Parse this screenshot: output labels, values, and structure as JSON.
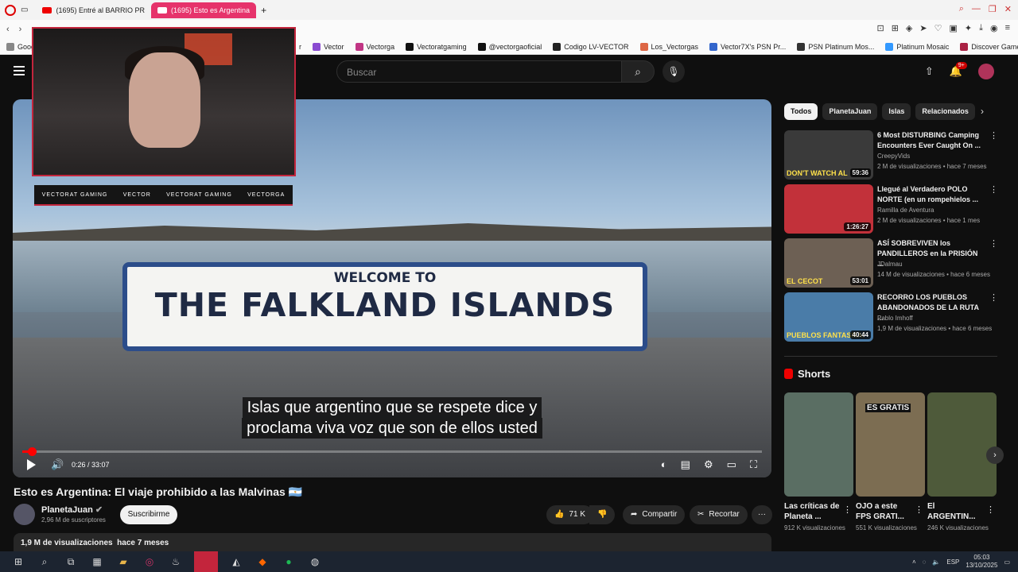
{
  "browser": {
    "tabs": [
      {
        "title": "(1695) Entré al BARRIO PR",
        "active": false
      },
      {
        "title": "(1695) Esto es Argentina",
        "active": true
      }
    ],
    "new_tab": "+",
    "bookmarks": [
      "Goog",
      "r",
      "Vector",
      "Vectorga",
      "Vectoratgaming",
      "@vectorgaoficial",
      "Codigo LV-VECTOR",
      "Los_Vectorgas",
      "Vector7X's PSN Pr...",
      "PSN Platinum Mos...",
      "Platinum Mosaic",
      "Discover Games -..."
    ]
  },
  "header": {
    "search_placeholder": "Buscar",
    "notifications_badge": "9+"
  },
  "video": {
    "sign_small": "WELCOME TO",
    "sign_big": "THE FALKLAND ISLANDS",
    "subtitle_line1": "Islas que argentino que se respete dice y",
    "subtitle_line2": "proclama viva voz que son de ellos usted",
    "time": "0:26 / 33:07",
    "progress_fraction": 0.013,
    "overlay_social": [
      "VECTORAT GAMING",
      "VECTOR",
      "VECTORAT GAMING",
      "VECTORGA"
    ],
    "title": "Esto es Argentina: El viaje prohibido a las Malvinas 🇦🇷"
  },
  "channel": {
    "name": "PlanetaJuan",
    "subscribers": "2,96 M de suscriptores",
    "subscribe_label": "Suscribirme"
  },
  "actions": {
    "likes": "71 K",
    "share": "Compartir",
    "clip": "Recortar",
    "more": "···"
  },
  "description": {
    "views": "1,9 M de visualizaciones",
    "age": "hace 7 meses"
  },
  "sidebar": {
    "chips": [
      "Todos",
      "PlanetaJuan",
      "Islas",
      "Relacionados"
    ],
    "recommended": [
      {
        "title": "6 Most DISTURBING Camping Encounters Ever Caught On ...",
        "channel": "CreepyVids",
        "meta": "2 M de visualizaciones • hace 7 meses",
        "duration": "59:36",
        "thumb_text": "DON'T WATCH AL",
        "color": "#3a3a3a"
      },
      {
        "title": "Llegué al Verdadero POLO NORTE (en un rompehielos ...",
        "channel": "Ramilla de Aventura",
        "meta": "2 M de visualizaciones • hace 1 mes",
        "duration": "1:26:27",
        "thumb_text": "",
        "color": "#c2313a"
      },
      {
        "title": "ASÍ SOBREVIVEN los PANDILLEROS en la PRISIÓN ...",
        "channel": "JDalmau",
        "meta": "14 M de visualizaciones • hace 6 meses",
        "duration": "53:01",
        "thumb_text": "EL CECOT",
        "color": "#6d6054"
      },
      {
        "title": "RECORRO LOS PUEBLOS ABANDONADOS DE LA RUTA ...",
        "channel": "Pablo Imhoff",
        "meta": "1,9 M de visualizaciones • hace 6 meses",
        "duration": "40:44",
        "thumb_text": "PUEBLOS FANTASMA!",
        "color": "#4a7ca8"
      }
    ],
    "shorts_title": "Shorts",
    "shorts": [
      {
        "title": "Las críticas de Planeta ...",
        "views": "912 K visualizaciones",
        "color": "#5a6e63",
        "thumb_text": ""
      },
      {
        "title": "OJO a este FPS GRATI...",
        "views": "551 K visualizaciones",
        "color": "#7c6d52",
        "thumb_text": "ES GRATIS"
      },
      {
        "title": "El ARGENTIN...",
        "views": "246 K visualizaciones",
        "color": "#4e5a3a",
        "thumb_text": ""
      }
    ]
  },
  "taskbar": {
    "lang": "ESP",
    "time": "05:03",
    "date": "13/10/2025"
  }
}
